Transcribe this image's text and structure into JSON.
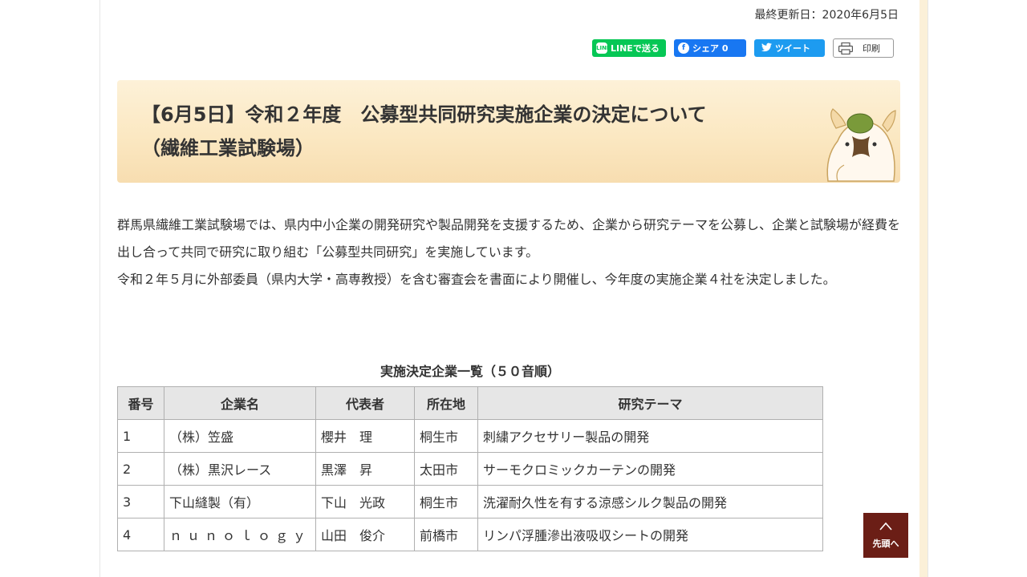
{
  "header": {
    "updated": "最終更新日：2020年6月5日"
  },
  "share": {
    "line": {
      "icon": "line-icon",
      "label": "LINEで送る",
      "icon_text": "LINE"
    },
    "facebook": {
      "icon": "facebook-icon",
      "label": "シェア 0",
      "icon_text": "f"
    },
    "twitter": {
      "icon": "twitter-bird-icon",
      "label": "ツイート"
    },
    "print": {
      "icon": "printer-icon",
      "label": "印刷"
    }
  },
  "article": {
    "title_line1": "【6月5日】令和２年度　公募型共同研究実施企業の決定について",
    "title_line2": "（繊維工業試験場）",
    "paragraph1": "群馬県繊維工業試験場では、県内中小企業の開発研究や製品開発を支援するため、企業から研究テーマを公募し、企業と試験場が経費を出し合って共同で研究に取り組む「公募型共同研究」を実施しています。",
    "paragraph2": "令和２年５月に外部委員（県内大学・高専教授）を含む審査会を書面により開催し、今年度の実施企業４社を決定しました。"
  },
  "table": {
    "caption": "実施決定企業一覧（５０音順）",
    "headers": [
      "番号",
      "企業名",
      "代表者",
      "所在地",
      "研究テーマ"
    ],
    "rows": [
      [
        "1",
        "（株）笠盛",
        "櫻井　理",
        "桐生市",
        "刺繍アクセサリー製品の開発"
      ],
      [
        "2",
        "（株）黒沢レース",
        "黒澤　昇",
        "太田市",
        "サーモクロミックカーテンの開発"
      ],
      [
        "3",
        "下山縫製（有）",
        "下山　光政",
        "桐生市",
        "洗濯耐久性を有する涼感シルク製品の開発"
      ],
      [
        "4",
        "ｎｕｎｏｌｏｇｙ",
        "山田　俊介",
        "前橋市",
        "リンパ浮腫滲出液吸収シートの開発"
      ]
    ]
  },
  "back_to_top": {
    "label": "先頭へ",
    "icon": "chevron-up-icon",
    "color": "#6b1e16"
  },
  "colors": {
    "line": "#06c755",
    "facebook": "#1877f2",
    "twitter": "#1d9bf0",
    "title_bg": "#fbe8c2"
  }
}
